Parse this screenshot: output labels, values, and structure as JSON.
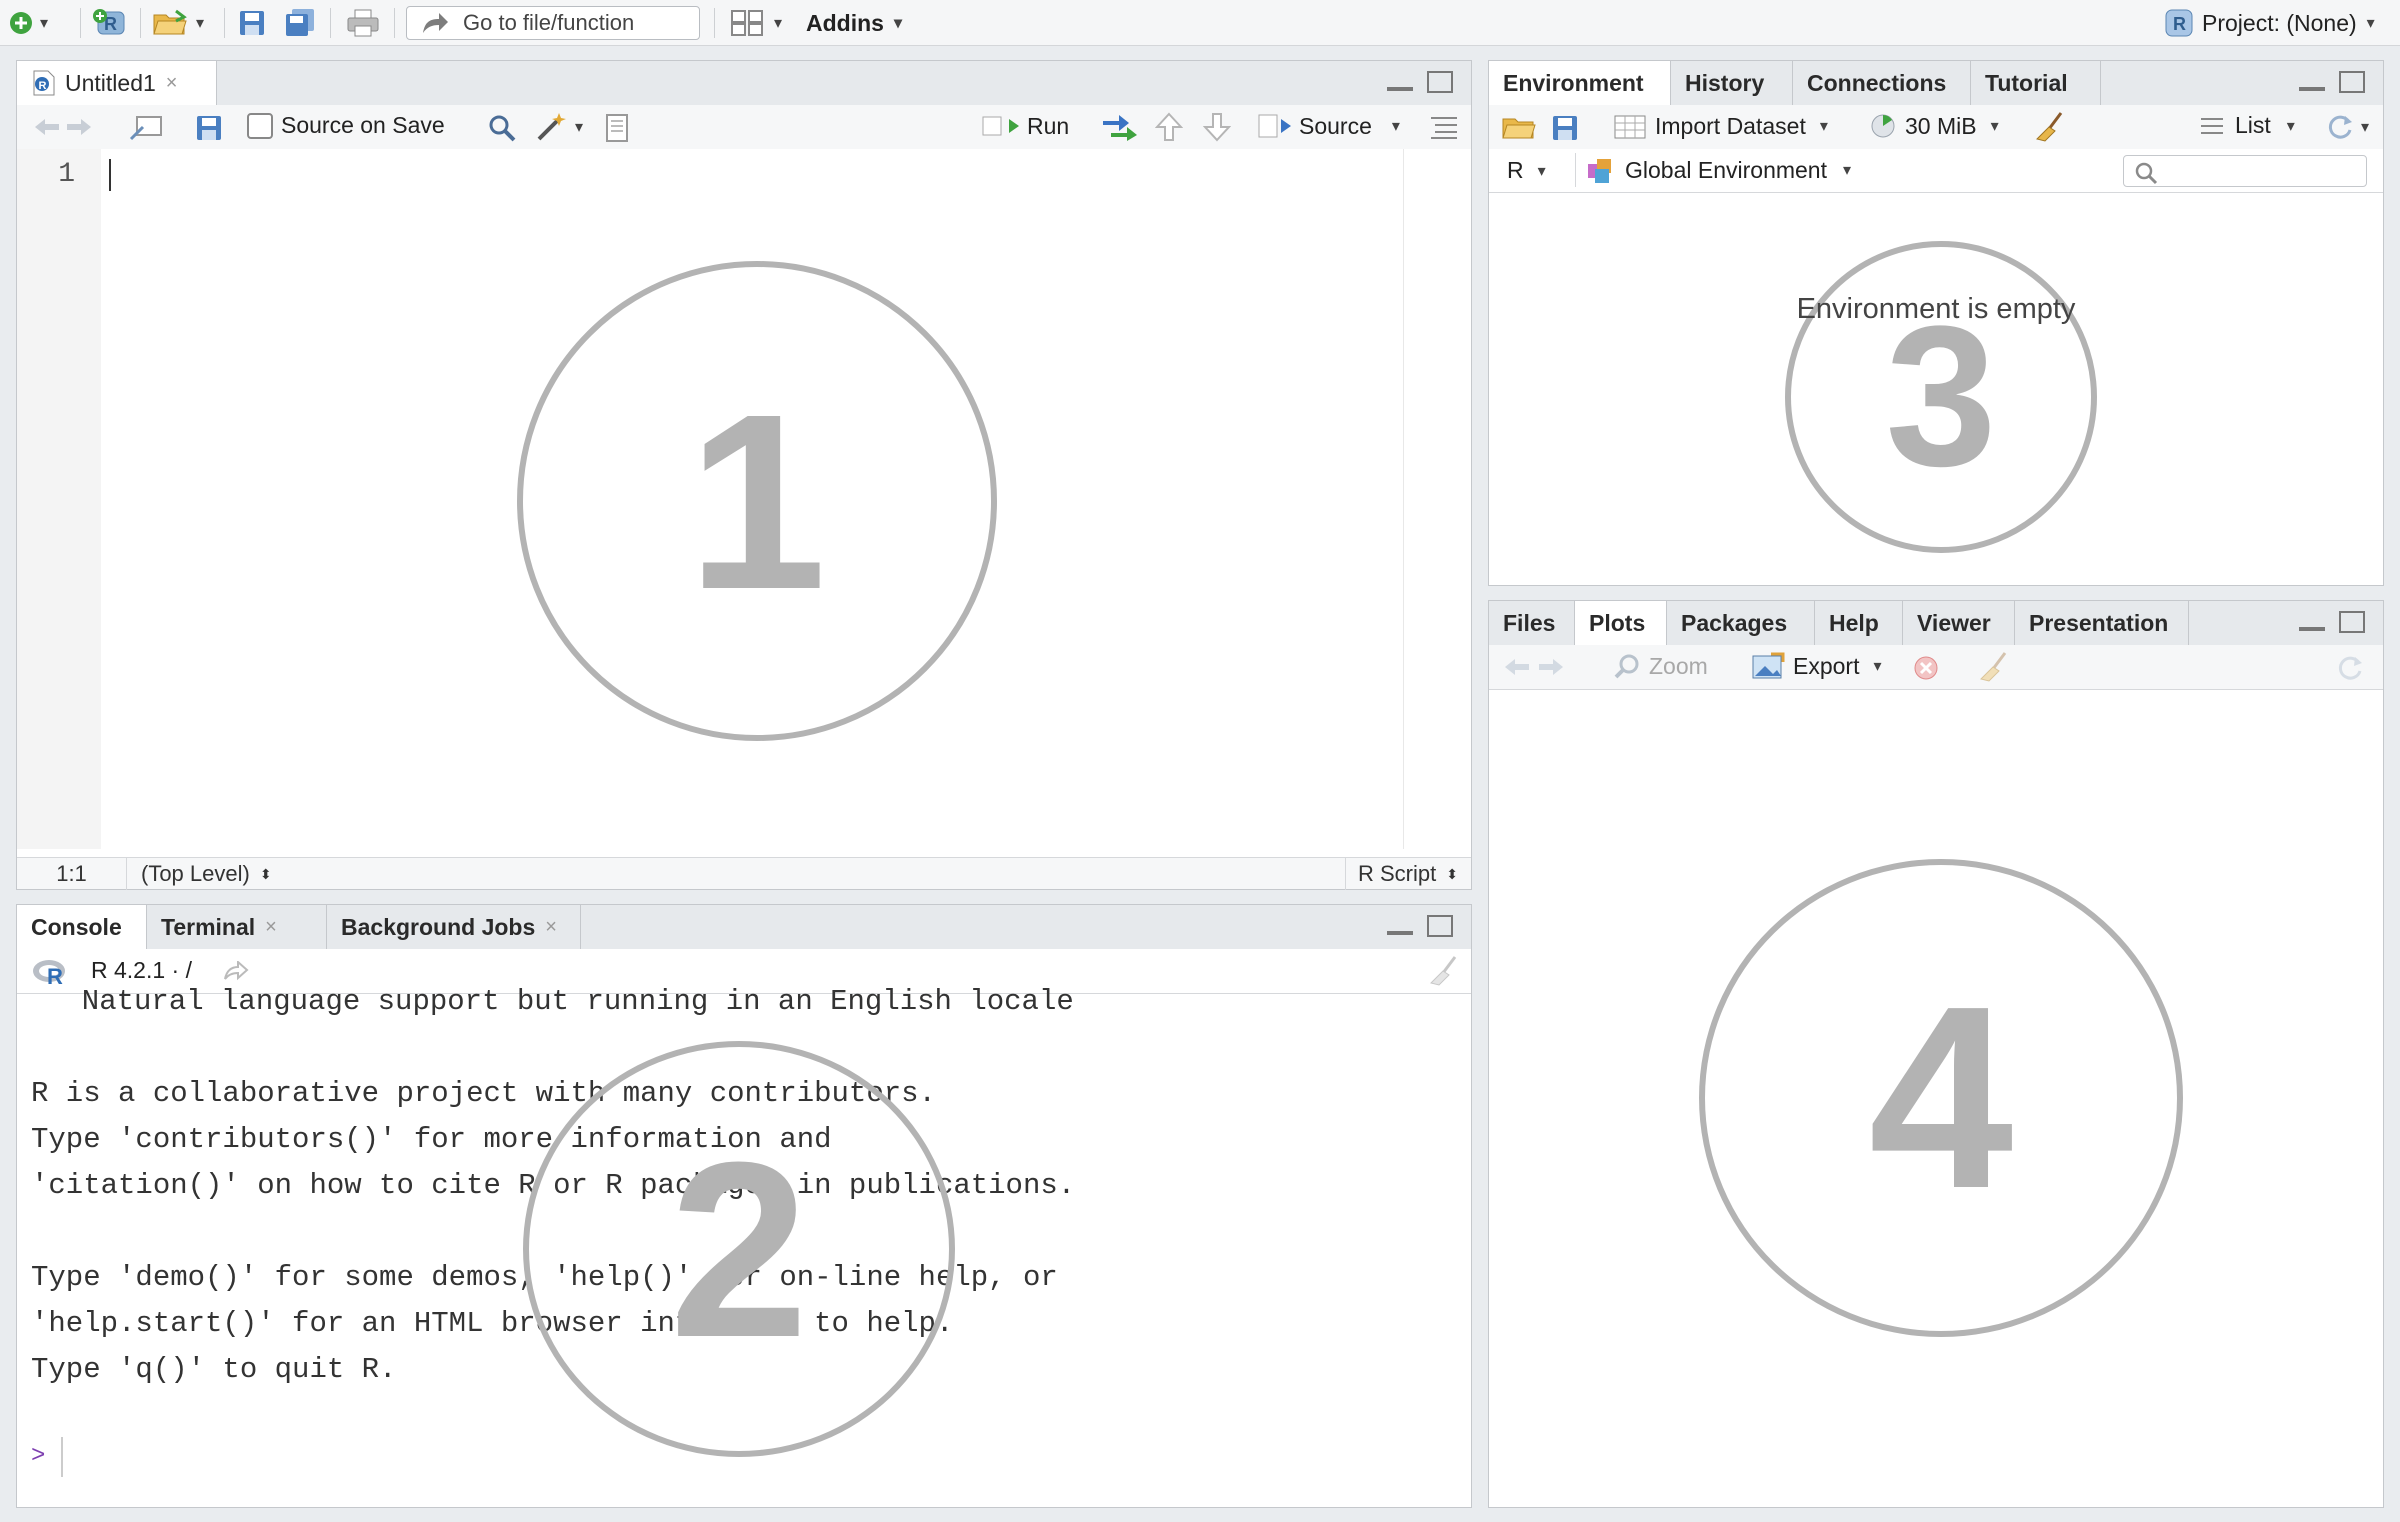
{
  "topbar": {
    "goto_placeholder": "Go to file/function",
    "addins_label": "Addins",
    "project_label": "Project: (None)"
  },
  "source_pane": {
    "tab_label": "Untitled1",
    "source_on_save": "Source on Save",
    "run_label": "Run",
    "source_label": "Source",
    "line_number": "1",
    "cursor_pos": "1:1",
    "scope": "(Top Level)",
    "file_type": "R Script",
    "overlay_number": "1"
  },
  "console_pane": {
    "tabs": [
      "Console",
      "Terminal",
      "Background Jobs"
    ],
    "r_version": "R 4.2.1 · /",
    "lines": [
      "  Natural language support but running in an English locale",
      "",
      "R is a collaborative project with many contributors.",
      "Type 'contributors()' for more information and",
      "'citation()' on how to cite R or R packages in publications.",
      "",
      "Type 'demo()' for some demos, 'help()' for on-line help, or",
      "'help.start()' for an HTML browser interface to help.",
      "Type 'q()' to quit R."
    ],
    "prompt": ">",
    "overlay_number": "2"
  },
  "env_pane": {
    "tabs": [
      "Environment",
      "History",
      "Connections",
      "Tutorial"
    ],
    "import_dataset": "Import Dataset",
    "memory": "30 MiB",
    "view_mode": "List",
    "language": "R",
    "scope": "Global Environment",
    "empty_message": "Environment is empty",
    "overlay_number": "3"
  },
  "files_pane": {
    "tabs": [
      "Files",
      "Plots",
      "Packages",
      "Help",
      "Viewer",
      "Presentation"
    ],
    "zoom_label": "Zoom",
    "export_label": "Export",
    "overlay_number": "4"
  },
  "colors": {
    "accent_green": "#3fa33f",
    "accent_blue": "#3a74c4",
    "overlay_gray": "#b3b3b3"
  }
}
